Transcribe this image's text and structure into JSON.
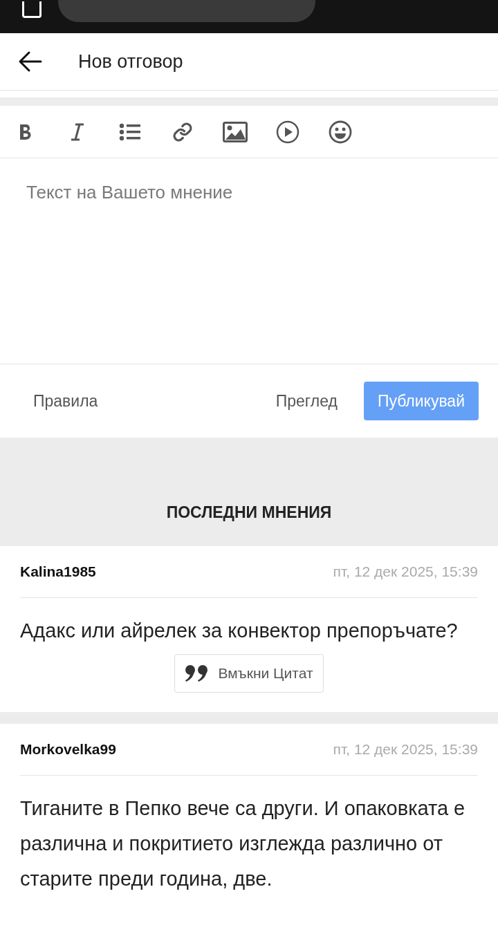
{
  "header": {
    "title": "Нов отговор"
  },
  "toolbar": [
    {
      "kind": "bold"
    },
    {
      "kind": "italic"
    },
    {
      "kind": "list"
    },
    {
      "kind": "link"
    },
    {
      "kind": "image"
    },
    {
      "kind": "video"
    },
    {
      "kind": "emoji"
    }
  ],
  "editor": {
    "placeholder": "Текст на Вашето мнение"
  },
  "actions": {
    "rules": "Правила",
    "preview": "Преглед",
    "publish": "Публикувай"
  },
  "latest": {
    "heading": "ПОСЛЕДНИ МНЕНИЯ",
    "posts": [
      {
        "author": "Kalina1985",
        "date": "пт, 12 дек 2025, 15:39",
        "text": "Адакс или айрелек за конвектор препоръчате?",
        "quote": "Вмъкни Цитат"
      },
      {
        "author": "Morkovelka99",
        "date": "пт, 12 дек 2025, 15:39",
        "text": "Тиганите в Пепко вече са други. И опаковката е различна и покритието изглежда различно от старите преди година, две."
      }
    ]
  }
}
